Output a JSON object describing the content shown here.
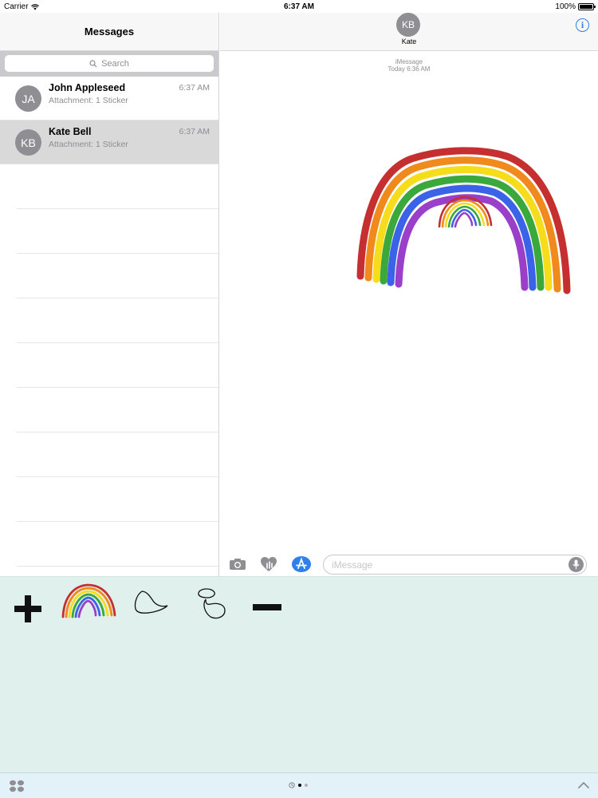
{
  "status_bar": {
    "carrier": "Carrier",
    "time": "6:37 AM",
    "battery": "100%"
  },
  "sidebar": {
    "title": "Messages",
    "search_placeholder": "Search",
    "conversations": [
      {
        "initials": "JA",
        "name": "John Appleseed",
        "preview": "Attachment: 1 Sticker",
        "time": "6:37 AM",
        "selected": false
      },
      {
        "initials": "KB",
        "name": "Kate Bell",
        "preview": "Attachment: 1 Sticker",
        "time": "6:37 AM",
        "selected": true
      }
    ]
  },
  "conversation": {
    "contact_initials": "KB",
    "contact_name": "Kate",
    "service": "iMessage",
    "timestamp": "Today 6:36 AM",
    "input_placeholder": "iMessage"
  },
  "icons": {
    "camera": "camera-icon",
    "digital_touch": "digital-touch-icon",
    "app_store": "app-store-icon",
    "microphone": "microphone-icon",
    "info": "info-icon",
    "apps_grid": "apps-grid-icon",
    "recents": "recents-icon",
    "expand": "chevron-up-icon"
  },
  "colors": {
    "accent": "#2f80ed",
    "drawer_bg": "#e0f0ec",
    "bottom_bar_bg": "#e3f1f9",
    "rainbow": [
      "#c62f2f",
      "#f08a1c",
      "#f5dd1b",
      "#3aa83a",
      "#3a63e8",
      "#9a3fc9"
    ]
  }
}
